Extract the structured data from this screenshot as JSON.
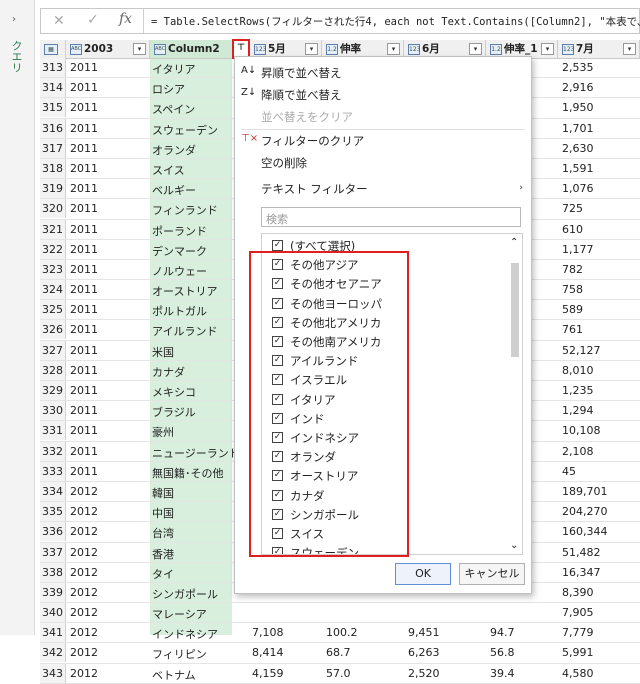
{
  "sidebar": {
    "label": "クエリ",
    "chevron": "›"
  },
  "formula": {
    "formula_text": "= Table.SelectRows(フィルターされた行4, each not Text.Contains([Column2], \"本表で、\""
  },
  "columns": [
    {
      "type_icon": "▦",
      "name": "2003"
    },
    {
      "type_icon": "ABC",
      "name": "Column2"
    },
    {
      "type_icon": "123",
      "name": "5月"
    },
    {
      "type_icon": "1.2",
      "name": "伸率"
    },
    {
      "type_icon": "123",
      "name": "6月"
    },
    {
      "type_icon": "1.2",
      "name": "伸率_1"
    },
    {
      "type_icon": "123",
      "name": "7月"
    }
  ],
  "rows": [
    {
      "n": "313",
      "year": "2011",
      "country": "イタリア",
      "c1": "",
      "c2": "",
      "c3": "",
      "c4": "",
      "c5": "2,535"
    },
    {
      "n": "314",
      "year": "2011",
      "country": "ロシア",
      "c1": "",
      "c2": "",
      "c3": "",
      "c4": "",
      "c5": "2,916"
    },
    {
      "n": "315",
      "year": "2011",
      "country": "スペイン",
      "c1": "",
      "c2": "",
      "c3": "",
      "c4": "",
      "c5": "1,950"
    },
    {
      "n": "316",
      "year": "2011",
      "country": "スウェーデン",
      "c1": "",
      "c2": "",
      "c3": "",
      "c4": "",
      "c5": "1,701"
    },
    {
      "n": "317",
      "year": "2011",
      "country": "オランダ",
      "c1": "",
      "c2": "",
      "c3": "",
      "c4": "",
      "c5": "2,630"
    },
    {
      "n": "318",
      "year": "2011",
      "country": "スイス",
      "c1": "",
      "c2": "",
      "c3": "",
      "c4": "",
      "c5": "1,591"
    },
    {
      "n": "319",
      "year": "2011",
      "country": "ベルギー",
      "c1": "",
      "c2": "",
      "c3": "",
      "c4": "",
      "c5": "1,076"
    },
    {
      "n": "320",
      "year": "2011",
      "country": "フィンランド",
      "c1": "",
      "c2": "",
      "c3": "",
      "c4": "",
      "c5": "725"
    },
    {
      "n": "321",
      "year": "2011",
      "country": "ポーランド",
      "c1": "",
      "c2": "",
      "c3": "",
      "c4": "",
      "c5": "610"
    },
    {
      "n": "322",
      "year": "2011",
      "country": "デンマーク",
      "c1": "",
      "c2": "",
      "c3": "",
      "c4": "",
      "c5": "1,177"
    },
    {
      "n": "323",
      "year": "2011",
      "country": "ノルウェー",
      "c1": "",
      "c2": "",
      "c3": "",
      "c4": "",
      "c5": "782"
    },
    {
      "n": "324",
      "year": "2011",
      "country": "オーストリア",
      "c1": "",
      "c2": "",
      "c3": "",
      "c4": "",
      "c5": "758"
    },
    {
      "n": "325",
      "year": "2011",
      "country": "ポルトガル",
      "c1": "",
      "c2": "",
      "c3": "",
      "c4": "",
      "c5": "589"
    },
    {
      "n": "326",
      "year": "2011",
      "country": "アイルランド",
      "c1": "",
      "c2": "",
      "c3": "",
      "c4": "",
      "c5": "761"
    },
    {
      "n": "327",
      "year": "2011",
      "country": "米国",
      "c1": "",
      "c2": "",
      "c3": "",
      "c4": "",
      "c5": "52,127"
    },
    {
      "n": "328",
      "year": "2011",
      "country": "カナダ",
      "c1": "",
      "c2": "",
      "c3": "",
      "c4": "",
      "c5": "8,010"
    },
    {
      "n": "329",
      "year": "2011",
      "country": "メキシコ",
      "c1": "",
      "c2": "",
      "c3": "",
      "c4": "",
      "c5": "1,235"
    },
    {
      "n": "330",
      "year": "2011",
      "country": "ブラジル",
      "c1": "",
      "c2": "",
      "c3": "",
      "c4": "",
      "c5": "1,294"
    },
    {
      "n": "331",
      "year": "2011",
      "country": "豪州",
      "c1": "",
      "c2": "",
      "c3": "",
      "c4": "",
      "c5": "10,108"
    },
    {
      "n": "332",
      "year": "2011",
      "country": "ニュージーランド",
      "c1": "",
      "c2": "",
      "c3": "",
      "c4": "",
      "c5": "2,108"
    },
    {
      "n": "333",
      "year": "2011",
      "country": "無国籍･その他",
      "c1": "",
      "c2": "",
      "c3": "",
      "c4": "",
      "c5": "45"
    },
    {
      "n": "334",
      "year": "2012",
      "country": "韓国",
      "c1": "",
      "c2": "",
      "c3": "",
      "c4": "",
      "c5": "189,701"
    },
    {
      "n": "335",
      "year": "2012",
      "country": "中国",
      "c1": "",
      "c2": "",
      "c3": "",
      "c4": "",
      "c5": "204,270"
    },
    {
      "n": "336",
      "year": "2012",
      "country": "台湾",
      "c1": "",
      "c2": "",
      "c3": "",
      "c4": "",
      "c5": "160,344"
    },
    {
      "n": "337",
      "year": "2012",
      "country": "香港",
      "c1": "",
      "c2": "",
      "c3": "",
      "c4": "",
      "c5": "51,482"
    },
    {
      "n": "338",
      "year": "2012",
      "country": "タイ",
      "c1": "",
      "c2": "",
      "c3": "",
      "c4": "",
      "c5": "16,347"
    },
    {
      "n": "339",
      "year": "2012",
      "country": "シンガポール",
      "c1": "",
      "c2": "",
      "c3": "",
      "c4": "",
      "c5": "8,390"
    },
    {
      "n": "340",
      "year": "2012",
      "country": "マレーシア",
      "c1": "",
      "c2": "",
      "c3": "",
      "c4": "",
      "c5": "7,905"
    },
    {
      "n": "341",
      "year": "2012",
      "country": "インドネシア",
      "c1": "7,108",
      "c2": "100.2",
      "c3": "9,451",
      "c4": "94.7",
      "c5": "7,779"
    },
    {
      "n": "342",
      "year": "2012",
      "country": "フィリピン",
      "c1": "8,414",
      "c2": "68.7",
      "c3": "6,263",
      "c4": "56.8",
      "c5": "5,991"
    },
    {
      "n": "343",
      "year": "2012",
      "country": "ベトナム",
      "c1": "4,159",
      "c2": "57.0",
      "c3": "2,520",
      "c4": "39.4",
      "c5": "4,580"
    }
  ],
  "menu": {
    "sort_asc": "昇順で並べ替え",
    "sort_desc": "降順で並べ替え",
    "sort_clear": "並べ替えをクリア",
    "filter_clear": "フィルターのクリア",
    "remove_empty": "空の削除",
    "text_filter": "テキスト フィルター",
    "search_placeholder": "検索",
    "ok": "OK",
    "cancel": "キャンセル"
  },
  "filter_items": [
    "(すべて選択)",
    "その他アジア",
    "その他オセアニア",
    "その他ヨーロッパ",
    "その他北アメリカ",
    "その他南アメリカ",
    "アイルランド",
    "イスラエル",
    "イタリア",
    "インド",
    "インドネシア",
    "オランダ",
    "オーストリア",
    "カナダ",
    "シンガポール",
    "スイス",
    "スウェーデン"
  ],
  "colors": {
    "highlight": "#e02020",
    "column_bg": "#d8efdd"
  }
}
